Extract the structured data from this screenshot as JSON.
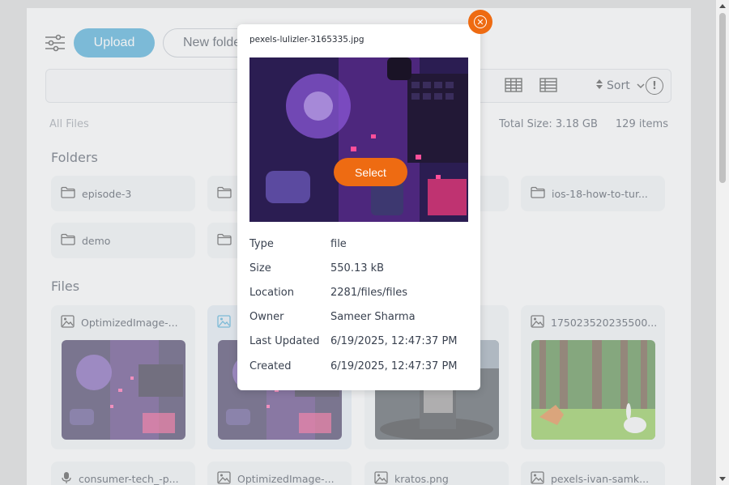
{
  "toolbar": {
    "upload_label": "Upload",
    "new_folder_label": "New folder"
  },
  "view": {
    "sort_label": "Sort",
    "info_glyph": "!"
  },
  "summary": {
    "all_files_label": "All Files",
    "total_size": "Total Size: 3.18 GB",
    "item_count": "129 items"
  },
  "folders": {
    "title": "Folders",
    "items": [
      {
        "name": "episode-3"
      },
      {
        "name": ""
      },
      {
        "name": "ios-18-how-to-tur..."
      },
      {
        "name": "demo"
      },
      {
        "name": ""
      }
    ]
  },
  "files": {
    "title": "Files",
    "items": [
      {
        "name": "OptimizedImage-...",
        "icon": "image-icon"
      },
      {
        "name": "",
        "icon": "image-icon"
      },
      {
        "name": "",
        "icon": "image-icon"
      },
      {
        "name": "175023520235500...",
        "icon": "image-icon"
      },
      {
        "name": "consumer-tech_-p...",
        "icon": "microphone-icon"
      },
      {
        "name": "OptimizedImage-...",
        "icon": "image-icon"
      },
      {
        "name": "kratos.png",
        "icon": "image-icon"
      },
      {
        "name": "pexels-ivan-samk...",
        "icon": "image-icon"
      }
    ]
  },
  "modal": {
    "filename": "pexels-lulizler-3165335.jpg",
    "select_label": "Select",
    "details": [
      {
        "key": "Type",
        "value": "file"
      },
      {
        "key": "Size",
        "value": "550.13 kB"
      },
      {
        "key": "Location",
        "value": "2281/files/files"
      },
      {
        "key": "Owner",
        "value": "Sameer Sharma"
      },
      {
        "key": "Last Updated",
        "value": "6/19/2025, 12:47:37 PM"
      },
      {
        "key": "Created",
        "value": "6/19/2025, 12:47:37 PM"
      }
    ]
  },
  "colors": {
    "accent_blue": "#2e9dcf",
    "accent_orange": "#ee6b12"
  }
}
